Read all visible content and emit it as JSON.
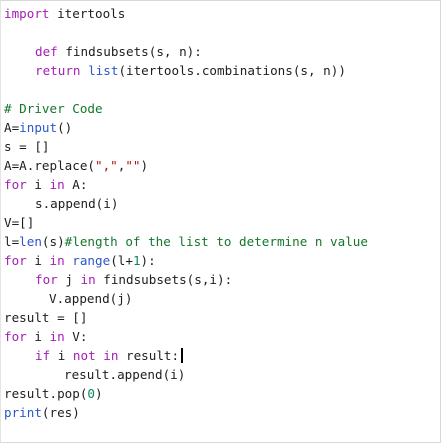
{
  "editor": {
    "lines": [
      [
        {
          "t": "import",
          "c": "kw"
        },
        {
          "t": " itertools",
          "c": ""
        }
      ],
      [],
      [
        {
          "t": "def",
          "c": "kw"
        },
        {
          "t": " findsubsets(s, n):",
          "c": ""
        }
      ],
      [
        {
          "t": "return",
          "c": "kw"
        },
        {
          "t": " ",
          "c": ""
        },
        {
          "t": "list",
          "c": "bi"
        },
        {
          "t": "(itertools.combinations(s, n))",
          "c": ""
        }
      ],
      [],
      [
        {
          "t": "# Driver Code",
          "c": "cm"
        }
      ],
      [
        {
          "t": "A=",
          "c": ""
        },
        {
          "t": "input",
          "c": "bi"
        },
        {
          "t": "()",
          "c": ""
        }
      ],
      [
        {
          "t": "s = []",
          "c": ""
        }
      ],
      [
        {
          "t": "A=A.replace(",
          "c": ""
        },
        {
          "t": "\",\"",
          "c": "str"
        },
        {
          "t": ",",
          "c": ""
        },
        {
          "t": "\"\"",
          "c": "str"
        },
        {
          "t": ")",
          "c": ""
        }
      ],
      [
        {
          "t": "for",
          "c": "kw"
        },
        {
          "t": " i ",
          "c": ""
        },
        {
          "t": "in",
          "c": "kw"
        },
        {
          "t": " A:",
          "c": ""
        }
      ],
      [
        {
          "t": "s.append(i)",
          "c": ""
        }
      ],
      [
        {
          "t": "V=[]",
          "c": ""
        }
      ],
      [
        {
          "t": "l=",
          "c": ""
        },
        {
          "t": "len",
          "c": "bi"
        },
        {
          "t": "(s)",
          "c": ""
        },
        {
          "t": "#length of the list to determine n value",
          "c": "cm"
        }
      ],
      [
        {
          "t": "for",
          "c": "kw"
        },
        {
          "t": " i ",
          "c": ""
        },
        {
          "t": "in",
          "c": "kw"
        },
        {
          "t": " ",
          "c": ""
        },
        {
          "t": "range",
          "c": "bi"
        },
        {
          "t": "(l+",
          "c": ""
        },
        {
          "t": "1",
          "c": "num"
        },
        {
          "t": "):",
          "c": ""
        }
      ],
      [
        {
          "t": "for",
          "c": "kw"
        },
        {
          "t": " j ",
          "c": ""
        },
        {
          "t": "in",
          "c": "kw"
        },
        {
          "t": " findsubsets(s,i):",
          "c": ""
        }
      ],
      [
        {
          "t": "V.append(j)",
          "c": ""
        }
      ],
      [
        {
          "t": "result = []",
          "c": ""
        }
      ],
      [
        {
          "t": "for",
          "c": "kw"
        },
        {
          "t": " i ",
          "c": ""
        },
        {
          "t": "in",
          "c": "kw"
        },
        {
          "t": " V:",
          "c": ""
        }
      ],
      [
        {
          "t": "if",
          "c": "kw"
        },
        {
          "t": " i ",
          "c": ""
        },
        {
          "t": "not",
          "c": "kw"
        },
        {
          "t": " ",
          "c": ""
        },
        {
          "t": "in",
          "c": "kw"
        },
        {
          "t": " result:",
          "c": ""
        }
      ],
      [
        {
          "t": "result.append(i)",
          "c": ""
        }
      ],
      [
        {
          "t": "result.pop(",
          "c": ""
        },
        {
          "t": "0",
          "c": "num"
        },
        {
          "t": ")",
          "c": ""
        }
      ],
      [
        {
          "t": "print",
          "c": "bi"
        },
        {
          "t": "(res)",
          "c": ""
        }
      ]
    ]
  }
}
